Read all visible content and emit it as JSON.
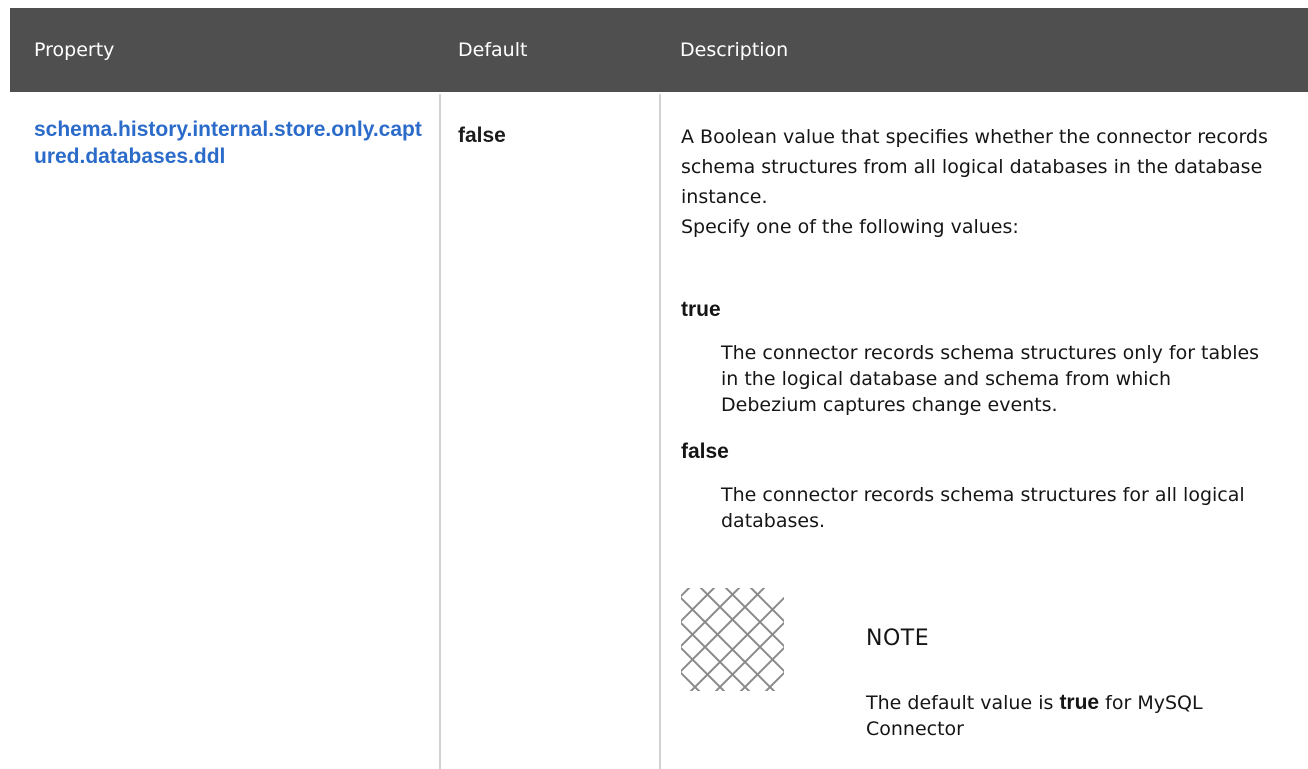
{
  "table": {
    "headers": {
      "property": "Property",
      "default": "Default",
      "description": "Description"
    }
  },
  "row": {
    "property_name": "schema.history.internal.store.only.captured.databases.ddl",
    "default_value": "false",
    "description_line1": "A Boolean value that specifies whether the connector records schema structures from all logical databases in the database instance.",
    "description_line2": "Specify one of the following values:",
    "options": [
      {
        "term": "true",
        "definition": "The connector records schema structures only for tables in the logical database and schema from which Debezium captures change events."
      },
      {
        "term": "false",
        "definition": "The connector records schema structures for all logical databases."
      }
    ],
    "note": {
      "icon": "note-icon",
      "title": "NOTE",
      "text_before": "The default value is ",
      "text_bold": "true",
      "text_after": " for MySQL Connector"
    }
  },
  "colors": {
    "header_bg": "#4f4f4f",
    "link": "#2b6bc9",
    "divider": "#d2d2d2"
  }
}
